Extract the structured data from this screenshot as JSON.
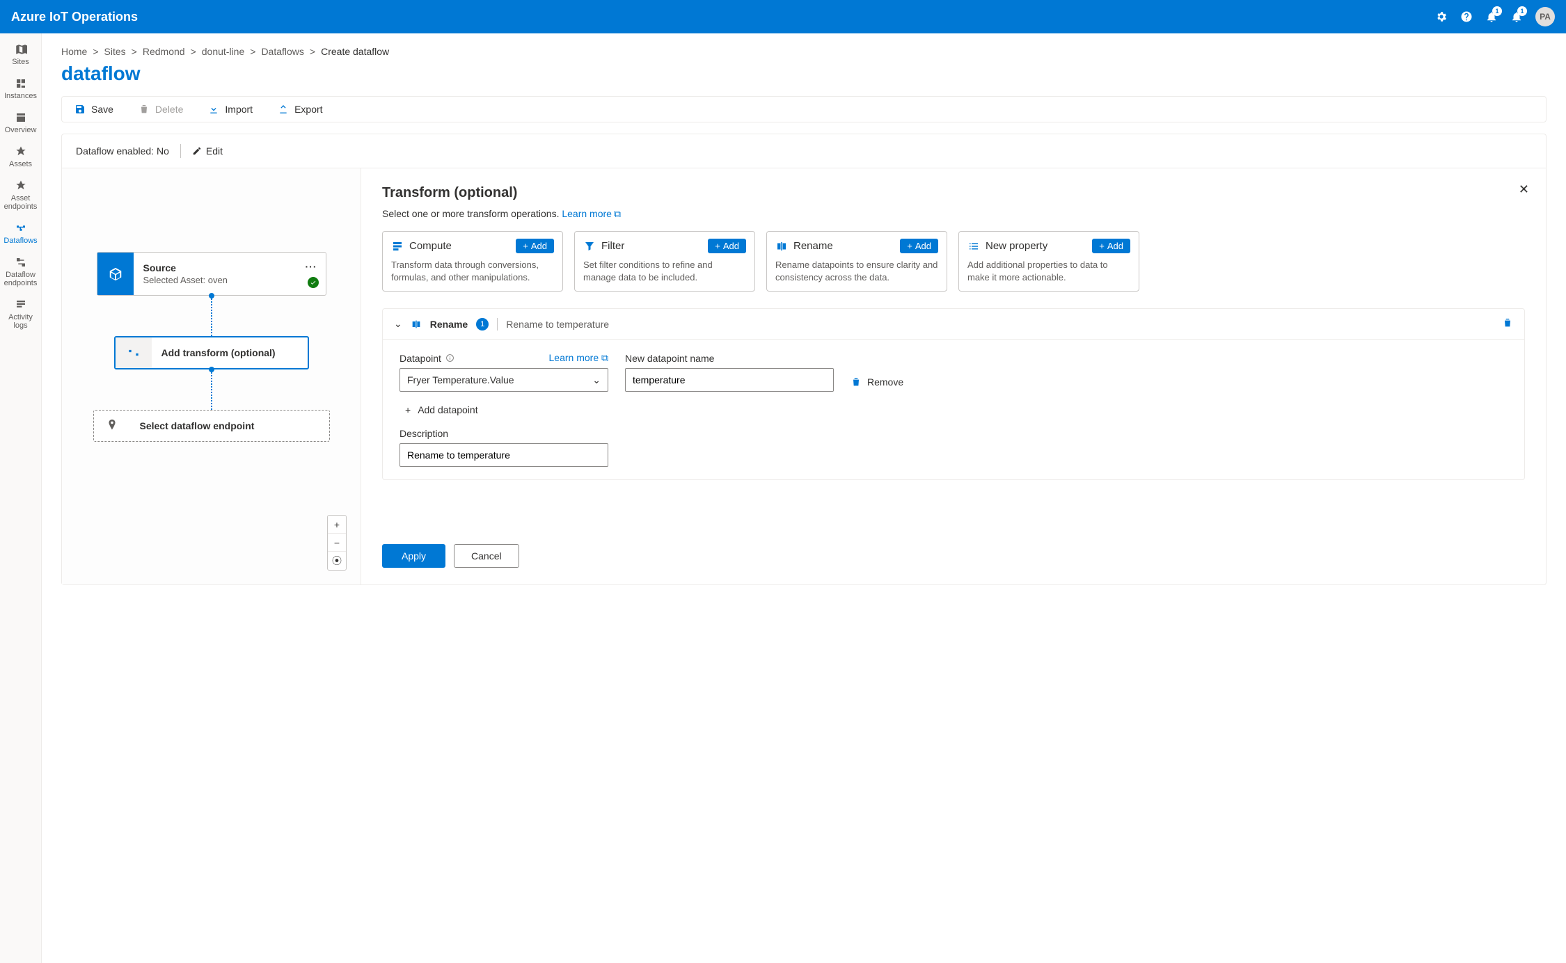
{
  "header": {
    "title": "Azure IoT Operations",
    "notif1_count": "1",
    "notif2_count": "1",
    "avatar": "PA"
  },
  "sidenav": {
    "items": [
      {
        "label": "Sites"
      },
      {
        "label": "Instances"
      },
      {
        "label": "Overview"
      },
      {
        "label": "Assets"
      },
      {
        "label": "Asset endpoints"
      },
      {
        "label": "Dataflows"
      },
      {
        "label": "Dataflow endpoints"
      },
      {
        "label": "Activity logs"
      }
    ]
  },
  "breadcrumb": {
    "items": [
      "Home",
      "Sites",
      "Redmond",
      "donut-line",
      "Dataflows"
    ],
    "current": "Create dataflow"
  },
  "page": {
    "title": "dataflow"
  },
  "toolbar": {
    "save": "Save",
    "delete": "Delete",
    "import": "Import",
    "export": "Export"
  },
  "status": {
    "enabled_label": "Dataflow enabled: No",
    "edit": "Edit"
  },
  "canvas": {
    "source": {
      "title": "Source",
      "sub": "Selected Asset: oven"
    },
    "transform": {
      "title": "Add transform (optional)"
    },
    "endpoint": {
      "title": "Select dataflow endpoint"
    }
  },
  "panel": {
    "title": "Transform (optional)",
    "desc_text": "Select one or more transform operations. ",
    "learn_more": "Learn more",
    "ops": {
      "compute": {
        "name": "Compute",
        "desc": "Transform data through conversions, formulas, and other manipulations.",
        "add": "Add"
      },
      "filter": {
        "name": "Filter",
        "desc": "Set filter conditions to refine and manage data to be included.",
        "add": "Add"
      },
      "rename": {
        "name": "Rename",
        "desc": "Rename datapoints to ensure clarity and consistency across the data.",
        "add": "Add"
      },
      "newprop": {
        "name": "New property",
        "desc": "Add additional properties to data to make it more actionable.",
        "add": "Add"
      }
    },
    "rename_section": {
      "title": "Rename",
      "count": "1",
      "subtitle": "Rename to temperature",
      "datapoint_label": "Datapoint",
      "learn_more": "Learn more",
      "datapoint_value": "Fryer Temperature.Value",
      "newname_label": "New datapoint name",
      "newname_value": "temperature",
      "remove": "Remove",
      "add_datapoint": "Add datapoint",
      "description_label": "Description",
      "description_value": "Rename to temperature"
    },
    "actions": {
      "apply": "Apply",
      "cancel": "Cancel"
    }
  }
}
